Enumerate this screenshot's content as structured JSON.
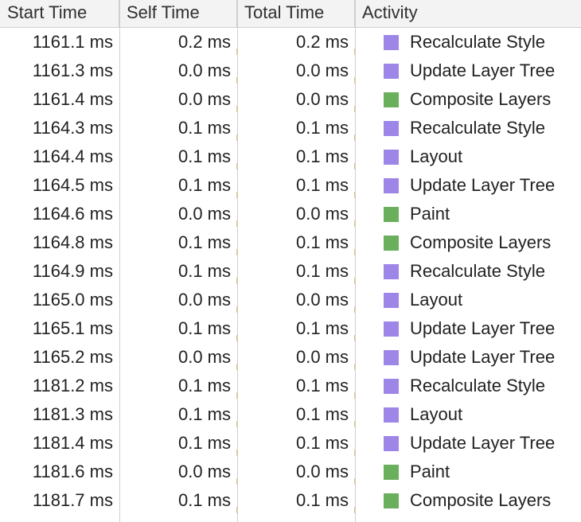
{
  "columns": [
    "Start Time",
    "Self Time",
    "Total Time",
    "Activity"
  ],
  "colors": {
    "rendering": "#9e86e8",
    "painting": "#6aaf5c"
  },
  "rows": [
    {
      "start": "1161.1 ms",
      "self": "0.2 ms",
      "total": "0.2 ms",
      "activity": "Recalculate Style",
      "category": "rendering"
    },
    {
      "start": "1161.3 ms",
      "self": "0.0 ms",
      "total": "0.0 ms",
      "activity": "Update Layer Tree",
      "category": "rendering"
    },
    {
      "start": "1161.4 ms",
      "self": "0.0 ms",
      "total": "0.0 ms",
      "activity": "Composite Layers",
      "category": "painting"
    },
    {
      "start": "1164.3 ms",
      "self": "0.1 ms",
      "total": "0.1 ms",
      "activity": "Recalculate Style",
      "category": "rendering"
    },
    {
      "start": "1164.4 ms",
      "self": "0.1 ms",
      "total": "0.1 ms",
      "activity": "Layout",
      "category": "rendering"
    },
    {
      "start": "1164.5 ms",
      "self": "0.1 ms",
      "total": "0.1 ms",
      "activity": "Update Layer Tree",
      "category": "rendering"
    },
    {
      "start": "1164.6 ms",
      "self": "0.0 ms",
      "total": "0.0 ms",
      "activity": "Paint",
      "category": "painting"
    },
    {
      "start": "1164.8 ms",
      "self": "0.1 ms",
      "total": "0.1 ms",
      "activity": "Composite Layers",
      "category": "painting"
    },
    {
      "start": "1164.9 ms",
      "self": "0.1 ms",
      "total": "0.1 ms",
      "activity": "Recalculate Style",
      "category": "rendering"
    },
    {
      "start": "1165.0 ms",
      "self": "0.0 ms",
      "total": "0.0 ms",
      "activity": "Layout",
      "category": "rendering"
    },
    {
      "start": "1165.1 ms",
      "self": "0.1 ms",
      "total": "0.1 ms",
      "activity": "Update Layer Tree",
      "category": "rendering"
    },
    {
      "start": "1165.2 ms",
      "self": "0.0 ms",
      "total": "0.0 ms",
      "activity": "Update Layer Tree",
      "category": "rendering"
    },
    {
      "start": "1181.2 ms",
      "self": "0.1 ms",
      "total": "0.1 ms",
      "activity": "Recalculate Style",
      "category": "rendering"
    },
    {
      "start": "1181.3 ms",
      "self": "0.1 ms",
      "total": "0.1 ms",
      "activity": "Layout",
      "category": "rendering"
    },
    {
      "start": "1181.4 ms",
      "self": "0.1 ms",
      "total": "0.1 ms",
      "activity": "Update Layer Tree",
      "category": "rendering"
    },
    {
      "start": "1181.6 ms",
      "self": "0.0 ms",
      "total": "0.0 ms",
      "activity": "Paint",
      "category": "painting"
    },
    {
      "start": "1181.7 ms",
      "self": "0.1 ms",
      "total": "0.1 ms",
      "activity": "Composite Layers",
      "category": "painting"
    }
  ]
}
